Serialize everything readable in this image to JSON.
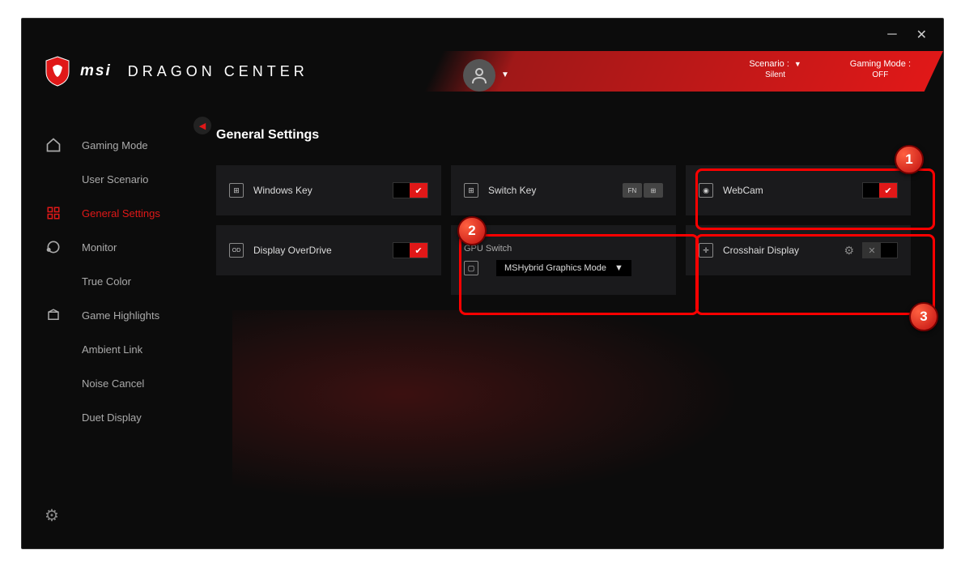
{
  "brand": {
    "name": "msi",
    "product": "DRAGON CENTER"
  },
  "header": {
    "scenario": {
      "label": "Scenario :",
      "value": "Silent"
    },
    "gaming": {
      "label": "Gaming Mode :",
      "value": "OFF"
    }
  },
  "sidebar": {
    "items": [
      {
        "label": "Gaming Mode",
        "icon": "home",
        "hasIcon": true,
        "active": false
      },
      {
        "label": "User Scenario",
        "icon": "",
        "hasIcon": false,
        "active": false
      },
      {
        "label": "General Settings",
        "icon": "grid",
        "hasIcon": true,
        "active": true
      },
      {
        "label": "Monitor",
        "icon": "orbit",
        "hasIcon": true,
        "active": false
      },
      {
        "label": "True Color",
        "icon": "",
        "hasIcon": false,
        "active": false
      },
      {
        "label": "Game Highlights",
        "icon": "box",
        "hasIcon": true,
        "active": false
      },
      {
        "label": "Ambient Link",
        "icon": "",
        "hasIcon": false,
        "active": false
      },
      {
        "label": "Noise Cancel",
        "icon": "",
        "hasIcon": false,
        "active": false
      },
      {
        "label": "Duet Display",
        "icon": "",
        "hasIcon": false,
        "active": false
      }
    ]
  },
  "page": {
    "title": "General Settings"
  },
  "cards": {
    "windowsKey": {
      "label": "Windows Key",
      "toggle": "on"
    },
    "switchKey": {
      "label": "Switch Key",
      "fn": "FN",
      "win": "⊞"
    },
    "webcam": {
      "label": "WebCam",
      "toggle": "on"
    },
    "overdrive": {
      "label": "Display OverDrive",
      "toggle": "on"
    },
    "gpu": {
      "title": "GPU Switch",
      "value": "MSHybrid Graphics Mode"
    },
    "crosshair": {
      "label": "Crosshair Display",
      "toggle": "off"
    }
  },
  "annotations": {
    "b1": "1",
    "b2": "2",
    "b3": "3"
  }
}
